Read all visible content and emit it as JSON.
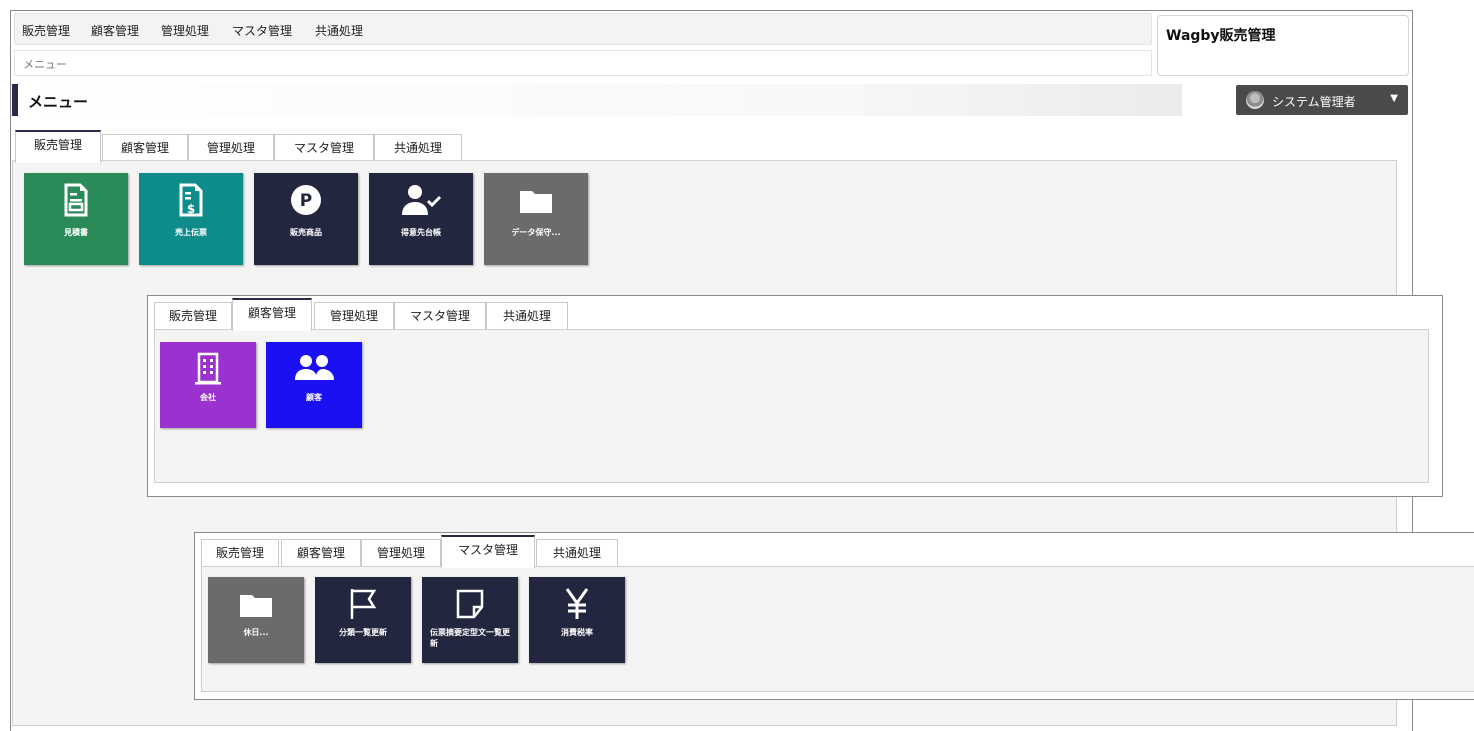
{
  "top_nav": [
    "販売管理",
    "顧客管理",
    "管理処理",
    "マスタ管理",
    "共通処理"
  ],
  "breadcrumb": "メニュー",
  "app_title": "Wagby販売管理",
  "page_title": "メニュー",
  "user_menu": {
    "label": "システム管理者",
    "caret": "▼"
  },
  "colors": {
    "green": "#2a8b58",
    "teal": "#0e8b8b",
    "navy": "#23263f",
    "gray": "#6b6b6b",
    "purple": "#9b32d0",
    "blue": "#1a10f2",
    "accent": "#2b2b45"
  },
  "panels": [
    {
      "tabs": [
        "販売管理",
        "顧客管理",
        "管理処理",
        "マスタ管理",
        "共通処理"
      ],
      "active_tab": "販売管理",
      "tiles": [
        {
          "label": "見積書",
          "icon": "document-icon",
          "color": "#2a8b58"
        },
        {
          "label": "売上伝票",
          "icon": "invoice-icon",
          "color": "#0e8b8b"
        },
        {
          "label": "販売商品",
          "icon": "parking-icon",
          "color": "#23263f"
        },
        {
          "label": "得意先台帳",
          "icon": "user-check-icon",
          "color": "#23263f"
        },
        {
          "label": "データ保守...",
          "icon": "folder-icon",
          "color": "#6b6b6b"
        }
      ]
    },
    {
      "tabs": [
        "販売管理",
        "顧客管理",
        "管理処理",
        "マスタ管理",
        "共通処理"
      ],
      "active_tab": "顧客管理",
      "tiles": [
        {
          "label": "会社",
          "icon": "building-icon",
          "color": "#9b32d0"
        },
        {
          "label": "顧客",
          "icon": "users-icon",
          "color": "#1a10f2"
        }
      ]
    },
    {
      "tabs": [
        "販売管理",
        "顧客管理",
        "管理処理",
        "マスタ管理",
        "共通処理"
      ],
      "active_tab": "マスタ管理",
      "tiles": [
        {
          "label": "休日...",
          "icon": "folder-icon",
          "color": "#6b6b6b"
        },
        {
          "label": "分類一覧更新",
          "icon": "flag-icon",
          "color": "#23263f"
        },
        {
          "label": "伝票摘要定型文一覧更新",
          "icon": "sticky-note-icon",
          "color": "#23263f"
        },
        {
          "label": "消費税率",
          "icon": "yen-icon",
          "color": "#23263f"
        }
      ]
    }
  ]
}
